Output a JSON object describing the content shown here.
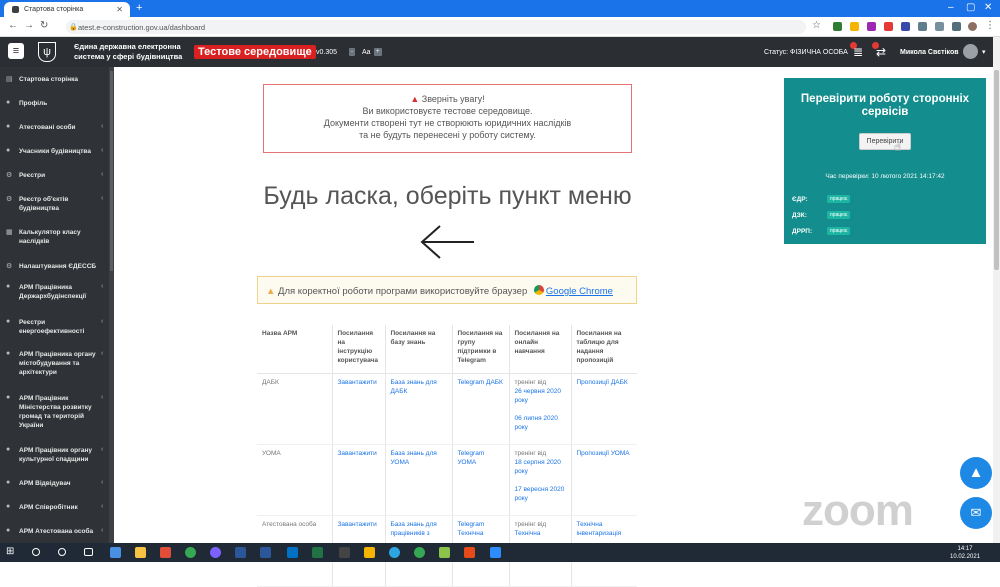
{
  "browser": {
    "tab_title": "Стартова сторінка",
    "url": "atest.e-construction.gov.ua/dashboard"
  },
  "header": {
    "system_title": "Єдина державна електронна система у сфері будівництва",
    "env_label": "Тестове середовище",
    "version": "v0.305",
    "font_minus": "-",
    "font_label": "Aa",
    "font_plus": "+",
    "status": "Статус: ФІЗИЧНА ОСОБА",
    "user_name": "Микола Свєтіков"
  },
  "sidebar": {
    "items": [
      {
        "label": "Стартова сторінка",
        "icon": "dashboard-icon",
        "chevron": ""
      },
      {
        "label": "Профіль",
        "icon": "user-icon",
        "chevron": ""
      },
      {
        "label": "Атестовані особи",
        "icon": "user-icon",
        "chevron": "‹"
      },
      {
        "label": "Учасники будівництва",
        "icon": "user-icon",
        "chevron": "‹"
      },
      {
        "label": "Реєстри",
        "icon": "gear-icon",
        "chevron": "‹"
      },
      {
        "label": "Реєстр об'єктів будівництва",
        "icon": "gear-icon",
        "chevron": "‹"
      },
      {
        "label": "Калькулятор класу наслідків",
        "icon": "calculator-icon",
        "chevron": ""
      },
      {
        "label": "Налаштування ЄДЕССБ",
        "icon": "gear-icon",
        "chevron": ""
      },
      {
        "label": "АРМ Працівника Держархбудінспекції",
        "icon": "user-icon",
        "chevron": "‹"
      },
      {
        "label": "Реєстри енергоефективності",
        "icon": "user-icon",
        "chevron": "‹"
      },
      {
        "label": "АРМ Працівника органу містобудування та архітектури",
        "icon": "user-icon",
        "chevron": "‹"
      },
      {
        "label": "АРМ Працівник Міністерства розвитку громад та територій України",
        "icon": "user-icon",
        "chevron": "‹"
      },
      {
        "label": "АРМ Працівник органу культурної спадщини",
        "icon": "user-icon",
        "chevron": "‹"
      },
      {
        "label": "АРМ Відвідувач",
        "icon": "user-icon",
        "chevron": "‹"
      },
      {
        "label": "АРМ Співробітник",
        "icon": "user-icon",
        "chevron": "‹"
      },
      {
        "label": "АРМ Атестована особа",
        "icon": "user-icon",
        "chevron": "‹"
      }
    ]
  },
  "notice": {
    "title": "Зверніть увагу!",
    "line1": "Ви використовуєте тестове середовище.",
    "line2": "Документи створені тут не створюють юридичних наслідків",
    "line3": "та не будуть перенесені у роботу систему."
  },
  "main": {
    "choose_text": "Будь ласка, оберіть пункт меню",
    "browser_note": "Для коректної роботи програми використовуйте браузер",
    "browser_link": "Google Chrome"
  },
  "services": {
    "title": "Перевірити роботу сторонніх сервісів",
    "check_button": "Перевірити",
    "last_check": "Час перевірки: 10 лютого 2021 14:17:42",
    "rows": [
      {
        "label": "ЄДР:",
        "badge": "працює"
      },
      {
        "label": "ДЗК:",
        "badge": "працює"
      },
      {
        "label": "ДРРП:",
        "badge": "працює"
      }
    ]
  },
  "arm_table": {
    "headers": [
      "Назва АРМ",
      "Посилання на інструкцію користувача",
      "Посилання на базу знань",
      "Посилання на групу підтримки в Telegram",
      "Посилання на онлайн навчання",
      "Посилання на таблицю для надання пропозицій"
    ],
    "rows": [
      {
        "name": "ДАБК",
        "instruction": "Завантажити",
        "kb": "База знань для ДАБК",
        "telegram": "Telegram ДАБК",
        "training_label": "тренінг від",
        "training_date1": "26 червня 2020 року",
        "training_date2": "06 липня 2020 року",
        "proposals": "Пропозиції ДАБК"
      },
      {
        "name": "УОМА",
        "instruction": "Завантажити",
        "kb": "База знань для УОМА",
        "telegram": "Telegram УОМА",
        "training_label": "тренінг від",
        "training_date1": "18 серпня 2020 року",
        "training_date2": "17 вересня 2020 року",
        "proposals": "Пропозиції УОМА"
      },
      {
        "name": "Атестована особа",
        "instruction": "Завантажити",
        "kb": "База знань для працівників з",
        "telegram": "Telegram Технічна",
        "training_label": "тренінг від",
        "training_date1": "Технічна",
        "training_date2": "",
        "proposals": "Технічна інвентаризація"
      }
    ]
  },
  "watermark": "zoom",
  "taskbar": {
    "time": "14:17",
    "date": "10.02.2021"
  },
  "colors": {
    "tabbar": "#1a73e8",
    "header": "#2b2f33",
    "sidebar": "#2f3337",
    "test_env": "#d92121",
    "services_panel": "#138d8d",
    "notice_border": "#e57373"
  }
}
